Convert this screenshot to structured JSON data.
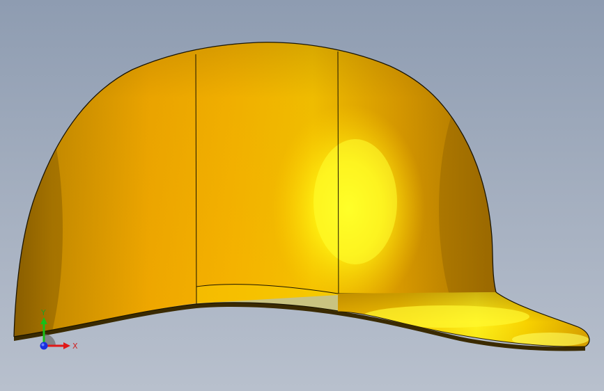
{
  "viewport": {
    "background_top": "#8e9cb1",
    "background_bottom": "#b8c0cd"
  },
  "model": {
    "part": "baseball-cap",
    "material_color": "#f2b400",
    "highlight_color": "#ffff10",
    "shadow_color": "#b07a00",
    "edge_color": "#1a1400"
  },
  "triad": {
    "x_label": "X",
    "y_label": "Y",
    "x_color": "#e01818",
    "y_color": "#18c018",
    "z_color": "#1830e0",
    "x_label_color": "#d02020",
    "y_label_color": "#20a020"
  }
}
